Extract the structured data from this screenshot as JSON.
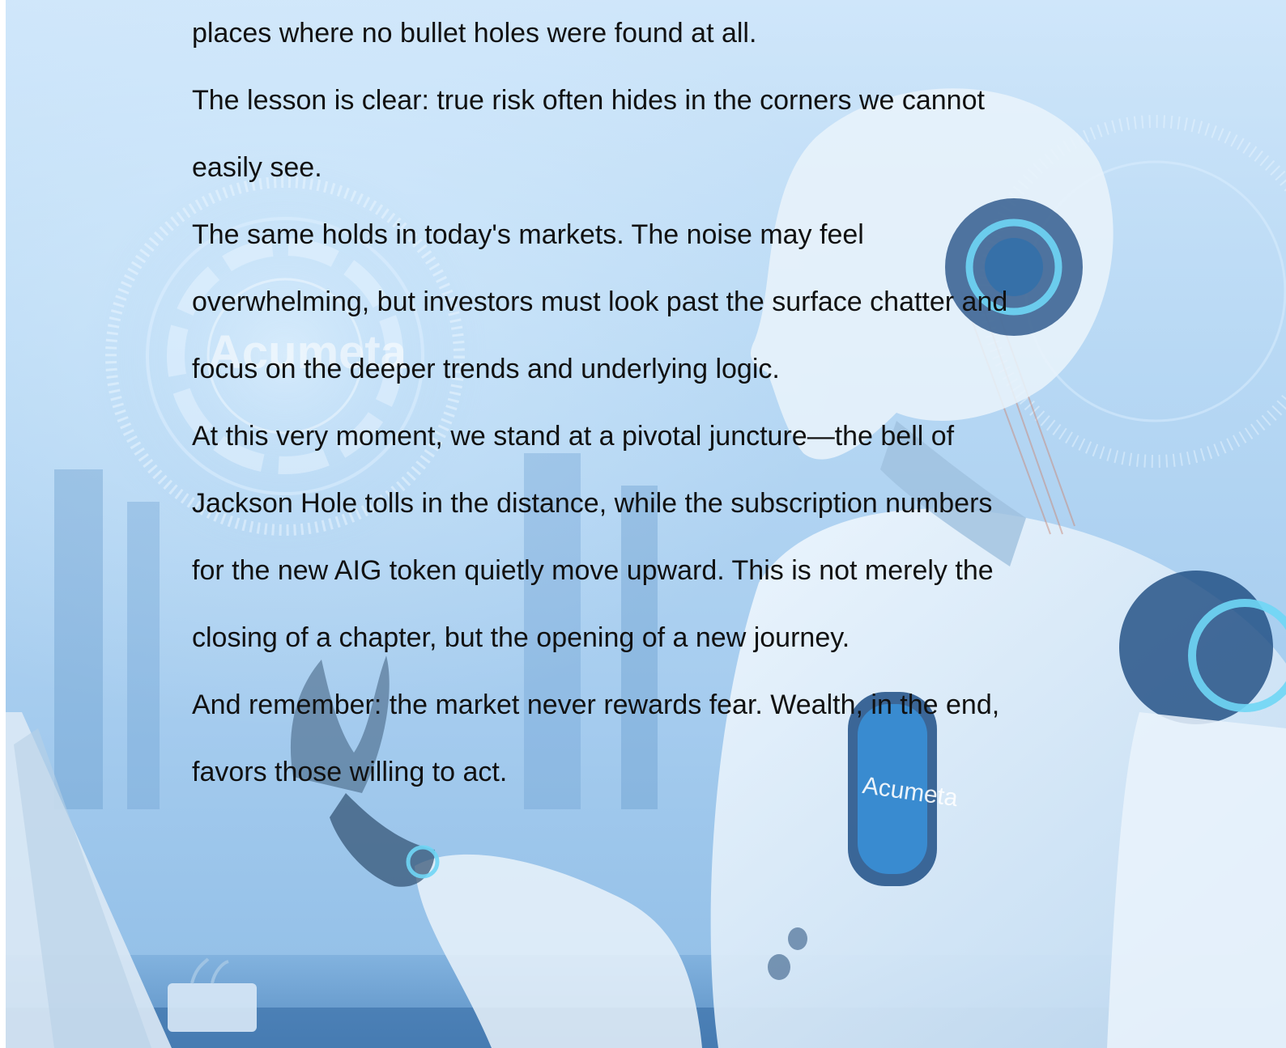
{
  "background": {
    "logo_text": "Acumeta",
    "badge_text": "Acumeta",
    "colors": {
      "sky_light": "#cfe6fa",
      "sky_mid": "#a7cdef",
      "robot_white": "#eef6fd",
      "robot_dark": "#1f4f86",
      "accent_glow": "#6fd6f5"
    }
  },
  "paragraphs": [
    {
      "lines": [
        "places where no bullet holes were found at all."
      ]
    },
    {
      "lines": [
        "The lesson is clear: true risk often hides in the corners we cannot",
        "easily see."
      ]
    },
    {
      "lines": [
        "The same holds in today's markets. The noise may feel",
        "overwhelming, but investors must look past the surface chatter and",
        "focus on the deeper trends and underlying logic."
      ]
    },
    {
      "lines": [
        "At this very moment, we stand at a pivotal juncture—the bell of",
        "Jackson Hole tolls in the distance, while the subscription numbers",
        "for the new AIG token quietly move upward. This is not merely the",
        "closing of a chapter, but the opening of a new journey."
      ]
    },
    {
      "lines": [
        "And remember: the market never rewards fear. Wealth, in the end,",
        "favors those willing to act."
      ]
    }
  ]
}
